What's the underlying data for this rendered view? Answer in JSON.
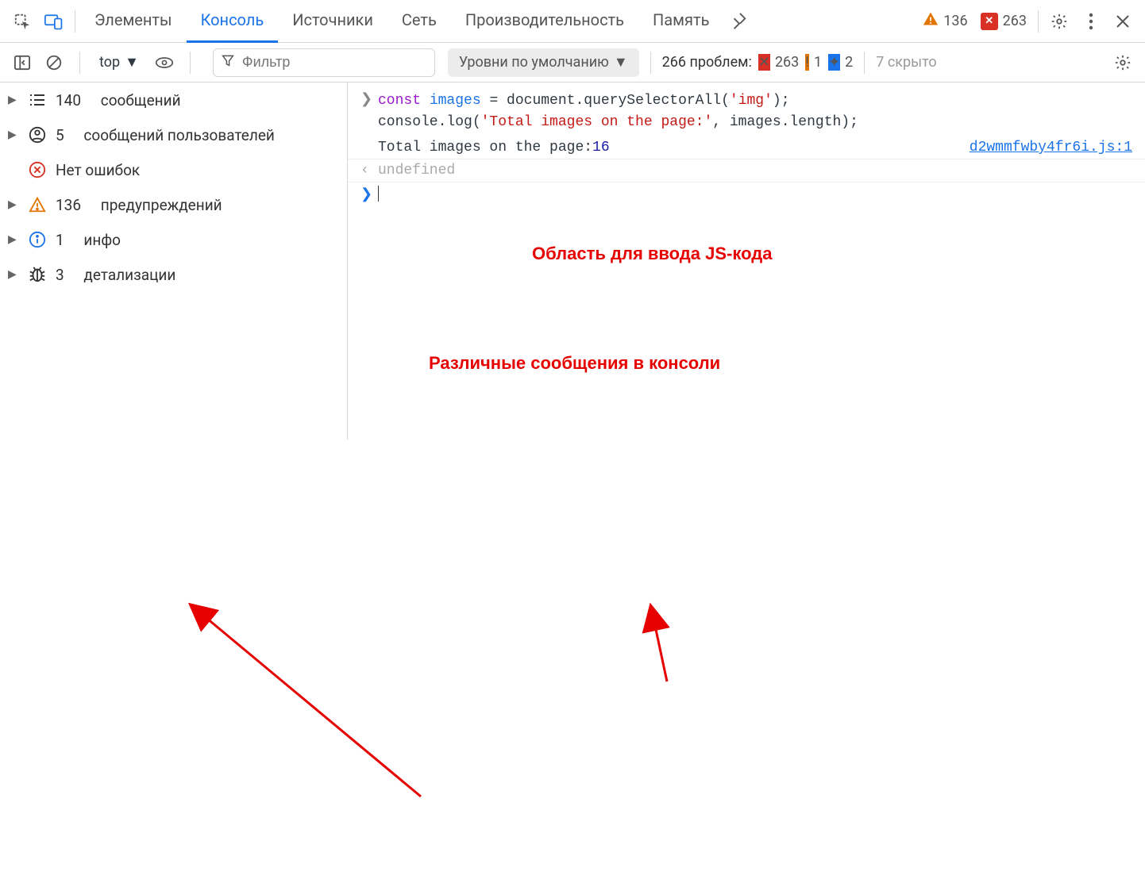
{
  "tabs": {
    "elements": "Элементы",
    "console": "Консоль",
    "sources": "Источники",
    "network": "Сеть",
    "performance": "Производительность",
    "memory": "Память"
  },
  "tabbar_badges": {
    "warnings": "136",
    "errors": "263"
  },
  "toolbar": {
    "context": "top",
    "filter_placeholder": "Фильтр",
    "levels": "Уровни по умолчанию",
    "problems_label": "266 проблем:",
    "problems_errors": "263",
    "problems_warns": "1",
    "problems_info": "2",
    "hidden_label": "7 скрыто"
  },
  "sidebar": {
    "messages_count": "140",
    "messages_label": "сообщений",
    "user_count": "5",
    "user_label": "сообщений пользователей",
    "errors_label": "Нет ошибок",
    "warns_count": "136",
    "warns_label": "предупреждений",
    "info_count": "1",
    "info_label": "инфо",
    "verbose_count": "3",
    "verbose_label": "детализации"
  },
  "console": {
    "code_line1_const": "const",
    "code_line1_var": "images",
    "code_line1_mid1": " = document.querySelectorAll(",
    "code_line1_str": "'img'",
    "code_line1_end": ");",
    "code_line2_a": "console.log(",
    "code_line2_str": "'Total images on the page:'",
    "code_line2_b": ", images.length);",
    "output_text": "Total images on the page: ",
    "output_num": "16",
    "source_link": "d2wmmfwby4fr6i.js:1",
    "undefined_label": "undefined"
  },
  "annotations": {
    "input_area": "Область для ввода JS-кода",
    "console_msgs": "Различные сообщения в консоли"
  }
}
